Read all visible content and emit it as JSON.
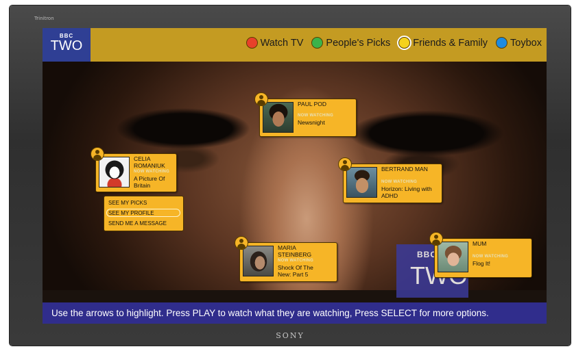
{
  "tv": {
    "brand": "Trinitron",
    "maker": "SONY"
  },
  "logo": {
    "line1": "BBC",
    "line2": "TWO"
  },
  "menu": [
    {
      "label": "Watch TV",
      "color": "#e8412a"
    },
    {
      "label": "People's Picks",
      "color": "#3bb34a"
    },
    {
      "label": "Friends & Family",
      "color": "#f5d21b"
    },
    {
      "label": "Toybox",
      "color": "#1d8be0"
    }
  ],
  "friends": [
    {
      "name": "PAUL POD",
      "status": "NOW WATCHING",
      "programme": "Newsnight"
    },
    {
      "name": "CELIA ROMANIUK",
      "status": "NOW WATCHING",
      "programme": "A Picture Of Britain"
    },
    {
      "name": "BERTRAND MAN",
      "status": "NOW WATCHING",
      "programme": "Horizon: Living with ADHD"
    },
    {
      "name": "MARIA STEINBERG",
      "status": "NOW WATCHING",
      "programme": "Shock Of The New: Part 5"
    },
    {
      "name": "MUM",
      "status": "NOW WATCHING",
      "programme": "Flog It!"
    }
  ],
  "options_menu": [
    "SEE MY PICKS",
    "SEE MY PROFILE",
    "SEND ME A MESSAGE"
  ],
  "watermark": {
    "line1": "BBC",
    "line2": "TWO"
  },
  "hint": "Use the arrows to highlight. Press PLAY to watch what they are watching, Press SELECT for more options."
}
